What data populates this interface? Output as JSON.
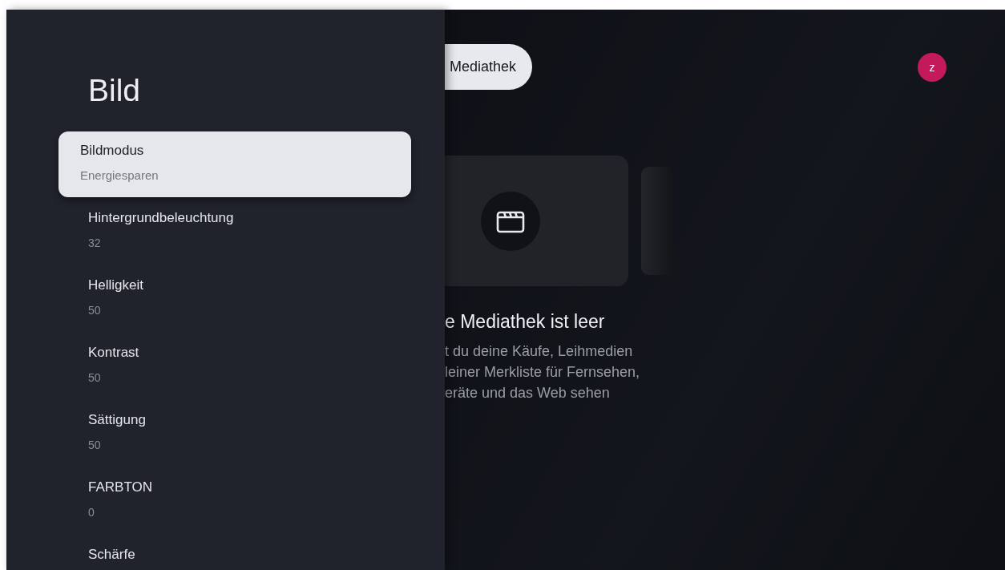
{
  "settings_panel": {
    "title": "Bild",
    "items": [
      {
        "title": "Bildmodus",
        "value": "Energiesparen",
        "selected": true
      },
      {
        "title": "Hintergrundbeleuchtung",
        "value": "32",
        "selected": false
      },
      {
        "title": "Helligkeit",
        "value": "50",
        "selected": false
      },
      {
        "title": "Kontrast",
        "value": "50",
        "selected": false
      },
      {
        "title": "Sättigung",
        "value": "50",
        "selected": false
      },
      {
        "title": "FARBTON",
        "value": "0",
        "selected": false
      },
      {
        "title": "Schärfe",
        "selected": false
      }
    ]
  },
  "library": {
    "tab": "Mediathek",
    "avatar": "z",
    "heading": "e Mediathek ist leer",
    "description": [
      "t du deine Käufe, Leihmedien",
      "leiner Merkliste für Fernsehen,",
      "eräte und das Web sehen"
    ]
  }
}
